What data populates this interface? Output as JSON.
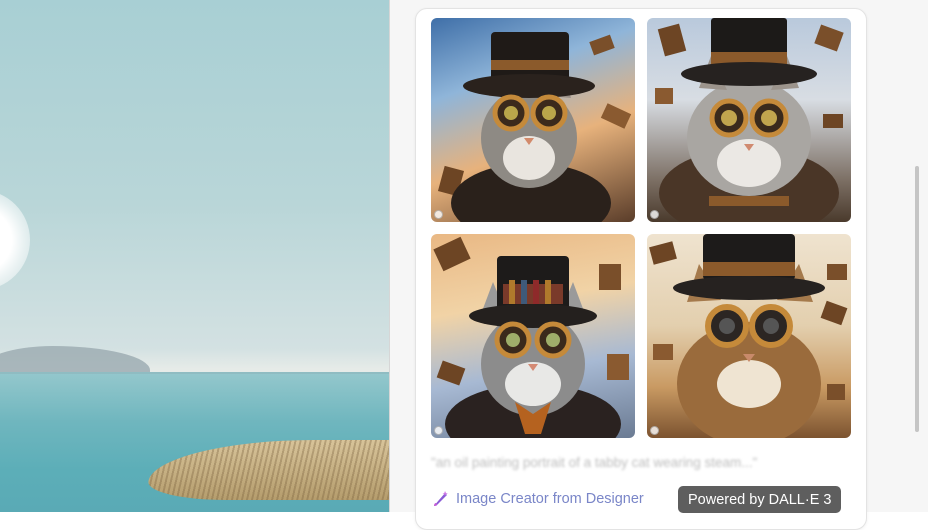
{
  "images": [
    {
      "alt": "Steampunk cat with top hat and goggles, flying books, sky background"
    },
    {
      "alt": "Fluffy gray steampunk cat with top hat and goggles among flying books"
    },
    {
      "alt": "Steampunk cat with books on top hat and goggles, sunset clouds"
    },
    {
      "alt": "Tabby steampunk cat with top hat and goggles, flying books"
    }
  ],
  "prompt": "\"an oil painting portrait of a tabby cat wearing steam...\"",
  "footer": {
    "creator_label": "Image Creator from Designer",
    "powered_label": "Powered by DALL·E 3",
    "creator_color": "#7a86c8",
    "powered_bg": "#5e5e5e"
  },
  "icons": {
    "creator": "paintbrush-sparkle-icon"
  }
}
